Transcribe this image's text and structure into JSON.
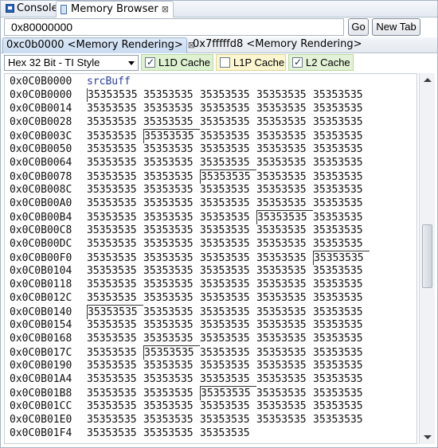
{
  "view_tabs": {
    "console": "Console",
    "memory_browser": "Memory Browser",
    "close": "⊠"
  },
  "address_bar": {
    "value": "0x80000000",
    "go_label": "Go",
    "new_tab_label": "New Tab"
  },
  "rendering_tabs": {
    "active": "0xc0b0000 <Memory Rendering>",
    "close": "⊠",
    "other": "0x7fffffd8 <Memory Rendering>"
  },
  "format": {
    "selected": "Hex 32 Bit - TI Style"
  },
  "cache": {
    "l1d": {
      "label": "L1D Cache",
      "checked": true,
      "color": "#def1d1"
    },
    "l1p": {
      "label": "L1P Cache",
      "checked": false,
      "color": "#fbf6cf"
    },
    "l2": {
      "label": "L2 Cache",
      "checked": true,
      "color": "#e3f2d6"
    }
  },
  "memory": {
    "header": {
      "address": "0x0C0B0000",
      "symbol": "srcBuff"
    },
    "rows": [
      {
        "address": "0x0C0B0000",
        "values": [
          "35353535",
          "35353535",
          "35353535",
          "35353535",
          "35353535"
        ]
      },
      {
        "address": "0x0C0B0014",
        "values": [
          "35353535",
          "35353535",
          "35353535",
          "35353535",
          "35353535"
        ]
      },
      {
        "address": "0x0C0B0028",
        "values": [
          "35353535",
          "35353535",
          "35353535",
          "35353535",
          "35353535"
        ]
      },
      {
        "address": "0x0C0B003C",
        "values": [
          "35353535",
          "35353535",
          "35353535",
          "35353535",
          "35353535"
        ]
      },
      {
        "address": "0x0C0B0050",
        "values": [
          "35353535",
          "35353535",
          "35353535",
          "35353535",
          "35353535"
        ]
      },
      {
        "address": "0x0C0B0064",
        "values": [
          "35353535",
          "35353535",
          "35353535",
          "35353535",
          "35353535"
        ]
      },
      {
        "address": "0x0C0B0078",
        "values": [
          "35353535",
          "35353535",
          "35353535",
          "35353535",
          "35353535"
        ]
      },
      {
        "address": "0x0C0B008C",
        "values": [
          "35353535",
          "35353535",
          "35353535",
          "35353535",
          "35353535"
        ]
      },
      {
        "address": "0x0C0B00A0",
        "values": [
          "35353535",
          "35353535",
          "35353535",
          "35353535",
          "35353535"
        ]
      },
      {
        "address": "0x0C0B00B4",
        "values": [
          "35353535",
          "35353535",
          "35353535",
          "35353535",
          "35353535"
        ]
      },
      {
        "address": "0x0C0B00C8",
        "values": [
          "35353535",
          "35353535",
          "35353535",
          "35353535",
          "35353535"
        ]
      },
      {
        "address": "0x0C0B00DC",
        "values": [
          "35353535",
          "35353535",
          "35353535",
          "35353535",
          "35353535"
        ]
      },
      {
        "address": "0x0C0B00F0",
        "values": [
          "35353535",
          "35353535",
          "35353535",
          "35353535",
          "35353535"
        ]
      },
      {
        "address": "0x0C0B0104",
        "values": [
          "35353535",
          "35353535",
          "35353535",
          "35353535",
          "35353535"
        ]
      },
      {
        "address": "0x0C0B0118",
        "values": [
          "35353535",
          "35353535",
          "35353535",
          "35353535",
          "35353535"
        ]
      },
      {
        "address": "0x0C0B012C",
        "values": [
          "35353535",
          "35353535",
          "35353535",
          "35353535",
          "35353535"
        ]
      },
      {
        "address": "0x0C0B0140",
        "values": [
          "35353535",
          "35353535",
          "35353535",
          "35353535",
          "35353535"
        ]
      },
      {
        "address": "0x0C0B0154",
        "values": [
          "35353535",
          "35353535",
          "35353535",
          "35353535",
          "35353535"
        ]
      },
      {
        "address": "0x0C0B0168",
        "values": [
          "35353535",
          "35353535",
          "35353535",
          "35353535",
          "35353535"
        ]
      },
      {
        "address": "0x0C0B017C",
        "values": [
          "35353535",
          "35353535",
          "35353535",
          "35353535",
          "35353535"
        ]
      },
      {
        "address": "0x0C0B0190",
        "values": [
          "35353535",
          "35353535",
          "35353535",
          "35353535",
          "35353535"
        ]
      },
      {
        "address": "0x0C0B01A4",
        "values": [
          "35353535",
          "35353535",
          "35353535",
          "35353535",
          "35353535"
        ]
      },
      {
        "address": "0x0C0B01B8",
        "values": [
          "35353535",
          "35353535",
          "35353535",
          "35353535",
          "35353535"
        ]
      },
      {
        "address": "0x0C0B01CC",
        "values": [
          "35353535",
          "35353535",
          "35353535",
          "35353535",
          "35353535"
        ]
      },
      {
        "address": "0x0C0B01E0",
        "values": [
          "35353535",
          "35353535",
          "35353535",
          "35353535",
          "35353535"
        ]
      },
      {
        "address": "0x0C0B01F4",
        "values": [
          "35353535",
          "35353535",
          "35353535"
        ]
      }
    ]
  }
}
